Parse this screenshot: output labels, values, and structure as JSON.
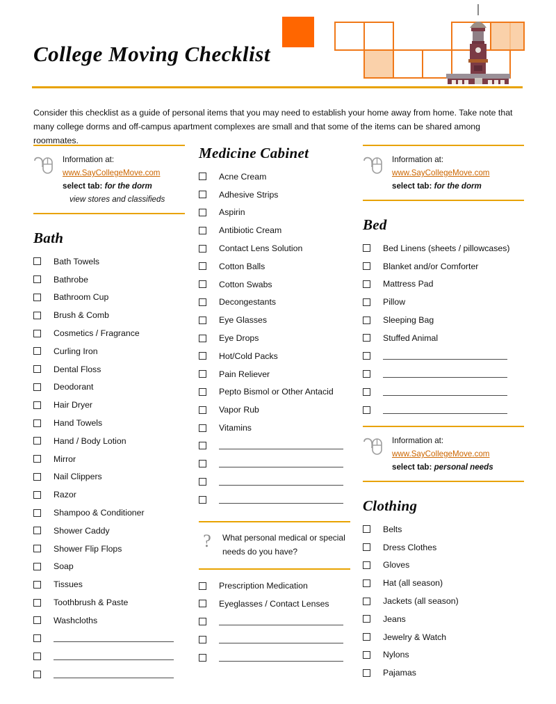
{
  "document": {
    "title": "College Moving Checklist",
    "intro": "Consider this checklist as a guide of personal items that you may need to establish your home away from home.  Take note that many college dorms and off-campus apartment complexes are small and that some of the items can be shared among roommates.",
    "accent_gold": "#e8a200",
    "accent_orange": "#ff6600",
    "link_color": "#cc6600",
    "building_color": "#7b3b45"
  },
  "info_boxes": {
    "left": {
      "icon": "mouse-icon",
      "label": "Information at:",
      "url": "www.SayCollegeMove.com",
      "tab_label": "select tab:",
      "tab_value": "for the dorm",
      "sub_note": "view stores and classifieds"
    },
    "right_top": {
      "icon": "mouse-icon",
      "label": "Information at:",
      "url": "www.SayCollegeMove.com",
      "tab_label": "select tab:",
      "tab_value": "for the dorm"
    },
    "right_bottom": {
      "icon": "mouse-icon",
      "label": "Information at:",
      "url": "www.SayCollegeMove.com",
      "tab_label": "select tab:",
      "tab_value": "personal needs"
    }
  },
  "question_box": {
    "icon": "question-mark-icon",
    "text": "What personal medical or special needs do you have?"
  },
  "sections": {
    "bath": {
      "title": "Bath",
      "items": [
        "Bath Towels",
        "Bathrobe",
        "Bathroom Cup",
        "Brush & Comb",
        "Cosmetics / Fragrance",
        "Curling Iron",
        "Dental Floss",
        "Deodorant",
        "Hair Dryer",
        "Hand Towels",
        "Hand / Body Lotion",
        "Mirror",
        "Nail Clippers",
        "Razor",
        "Shampoo & Conditioner",
        "Shower Caddy",
        "Shower Flip Flops",
        "Soap",
        "Tissues",
        "Toothbrush & Paste",
        "Washcloths"
      ],
      "blank_lines": 3
    },
    "medicine_cabinet": {
      "title": "Medicine Cabinet",
      "items": [
        "Acne Cream",
        "Adhesive Strips",
        "Aspirin",
        "Antibiotic Cream",
        "Contact Lens Solution",
        "Cotton Balls",
        "Cotton Swabs",
        "Decongestants",
        "Eye Glasses",
        "Eye Drops",
        "Hot/Cold Packs",
        "Pain Reliever",
        "Pepto Bismol or Other Antacid",
        "Vapor Rub",
        "Vitamins"
      ],
      "blank_lines": 4
    },
    "medical_needs": {
      "items": [
        "Prescription Medication",
        "Eyeglasses / Contact Lenses"
      ],
      "blank_lines": 3
    },
    "bed": {
      "title": "Bed",
      "items": [
        "Bed Linens (sheets / pillowcases)",
        "Blanket and/or Comforter",
        "Mattress Pad",
        "Pillow",
        "Sleeping Bag",
        "Stuffed Animal"
      ],
      "blank_lines": 4
    },
    "clothing": {
      "title": "Clothing",
      "items": [
        "Belts",
        "Dress Clothes",
        "Gloves",
        "Hat (all season)",
        "Jackets (all season)",
        "Jeans",
        "Jewelry & Watch",
        "Nylons",
        "Pajamas"
      ],
      "blank_lines": 0
    }
  }
}
